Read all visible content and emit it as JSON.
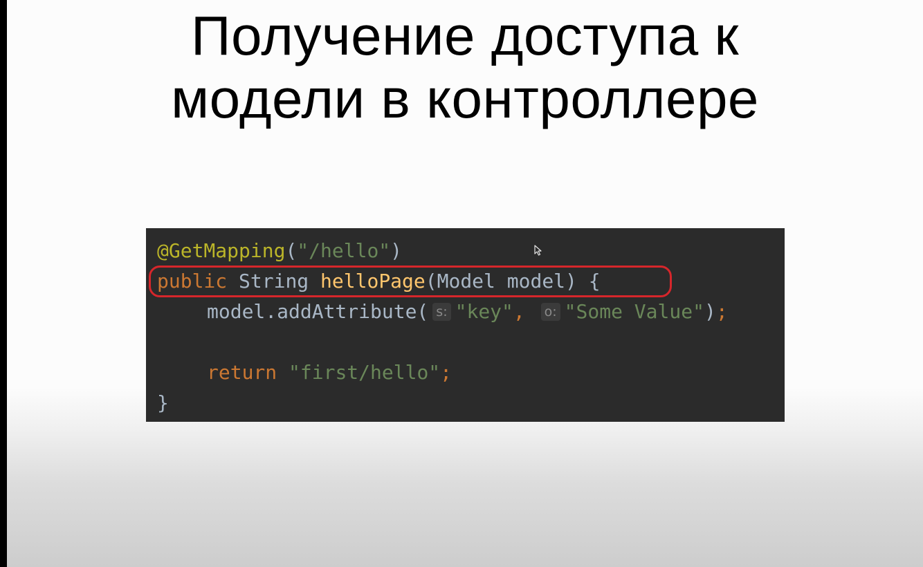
{
  "slide": {
    "title_lines": [
      "Получение доступа к",
      "модели в контроллере"
    ]
  },
  "code": {
    "line1": {
      "annotation": "@GetMapping",
      "open": "(",
      "path": "\"/hello\"",
      "close": ")"
    },
    "line2": {
      "keyword": "public",
      "type": "String",
      "method": "helloPage",
      "params": "(Model model) {"
    },
    "line3": {
      "call": "model.addAttribute(",
      "hint_s": "s:",
      "arg1": "\"key\"",
      "comma": ",",
      "hint_o": "o:",
      "arg2": "\"Some Value\"",
      "close": ")",
      "semi": ";"
    },
    "line5": {
      "keyword": "return",
      "value": "\"first/hello\"",
      "semi": ";"
    },
    "line6": {
      "brace": "}"
    }
  },
  "colors": {
    "highlight_border": "#d6262b",
    "code_background": "#2b2b2b",
    "annotation": "#bbb529",
    "string": "#6a8759",
    "keyword": "#cc7832",
    "method": "#ffc66d"
  },
  "icons": {
    "cursor": "mouse-pointer-icon"
  }
}
